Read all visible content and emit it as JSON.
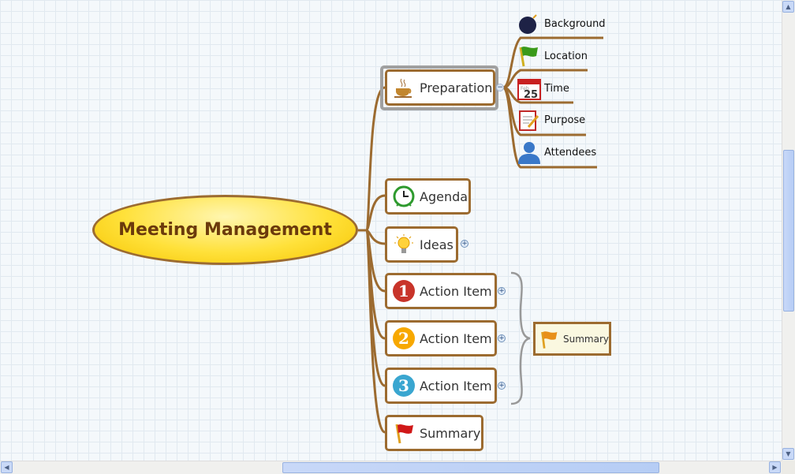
{
  "central_topic": "Meeting Management",
  "topics": [
    {
      "label": "Preparation",
      "icon": "coffee-cup-icon",
      "selected": true,
      "collapsible": true
    },
    {
      "label": "Agenda",
      "icon": "alarm-clock-icon"
    },
    {
      "label": "Ideas",
      "icon": "lightbulb-icon",
      "expandable": true
    },
    {
      "label": "Action Item",
      "icon": "number-1-icon",
      "expandable": true
    },
    {
      "label": "Action Item",
      "icon": "number-2-icon",
      "expandable": true
    },
    {
      "label": "Action Item",
      "icon": "number-3-icon",
      "expandable": true
    },
    {
      "label": "Summary",
      "icon": "red-flag-icon"
    }
  ],
  "subtopics": [
    {
      "label": "Background",
      "icon": "bomb-icon"
    },
    {
      "label": "Location",
      "icon": "green-flag-icon"
    },
    {
      "label": "Time",
      "icon": "calendar-icon",
      "calendar_day": "25",
      "calendar_month": "Feb"
    },
    {
      "label": "Purpose",
      "icon": "clipboard-icon"
    },
    {
      "label": "Attendees",
      "icon": "person-icon"
    }
  ],
  "summary_callout": {
    "label": "Summary",
    "icon": "orange-flag-icon"
  },
  "colors": {
    "branch": "#9c6b30",
    "central_fill": "#ffe13a",
    "central_text": "#6b3a0c"
  }
}
